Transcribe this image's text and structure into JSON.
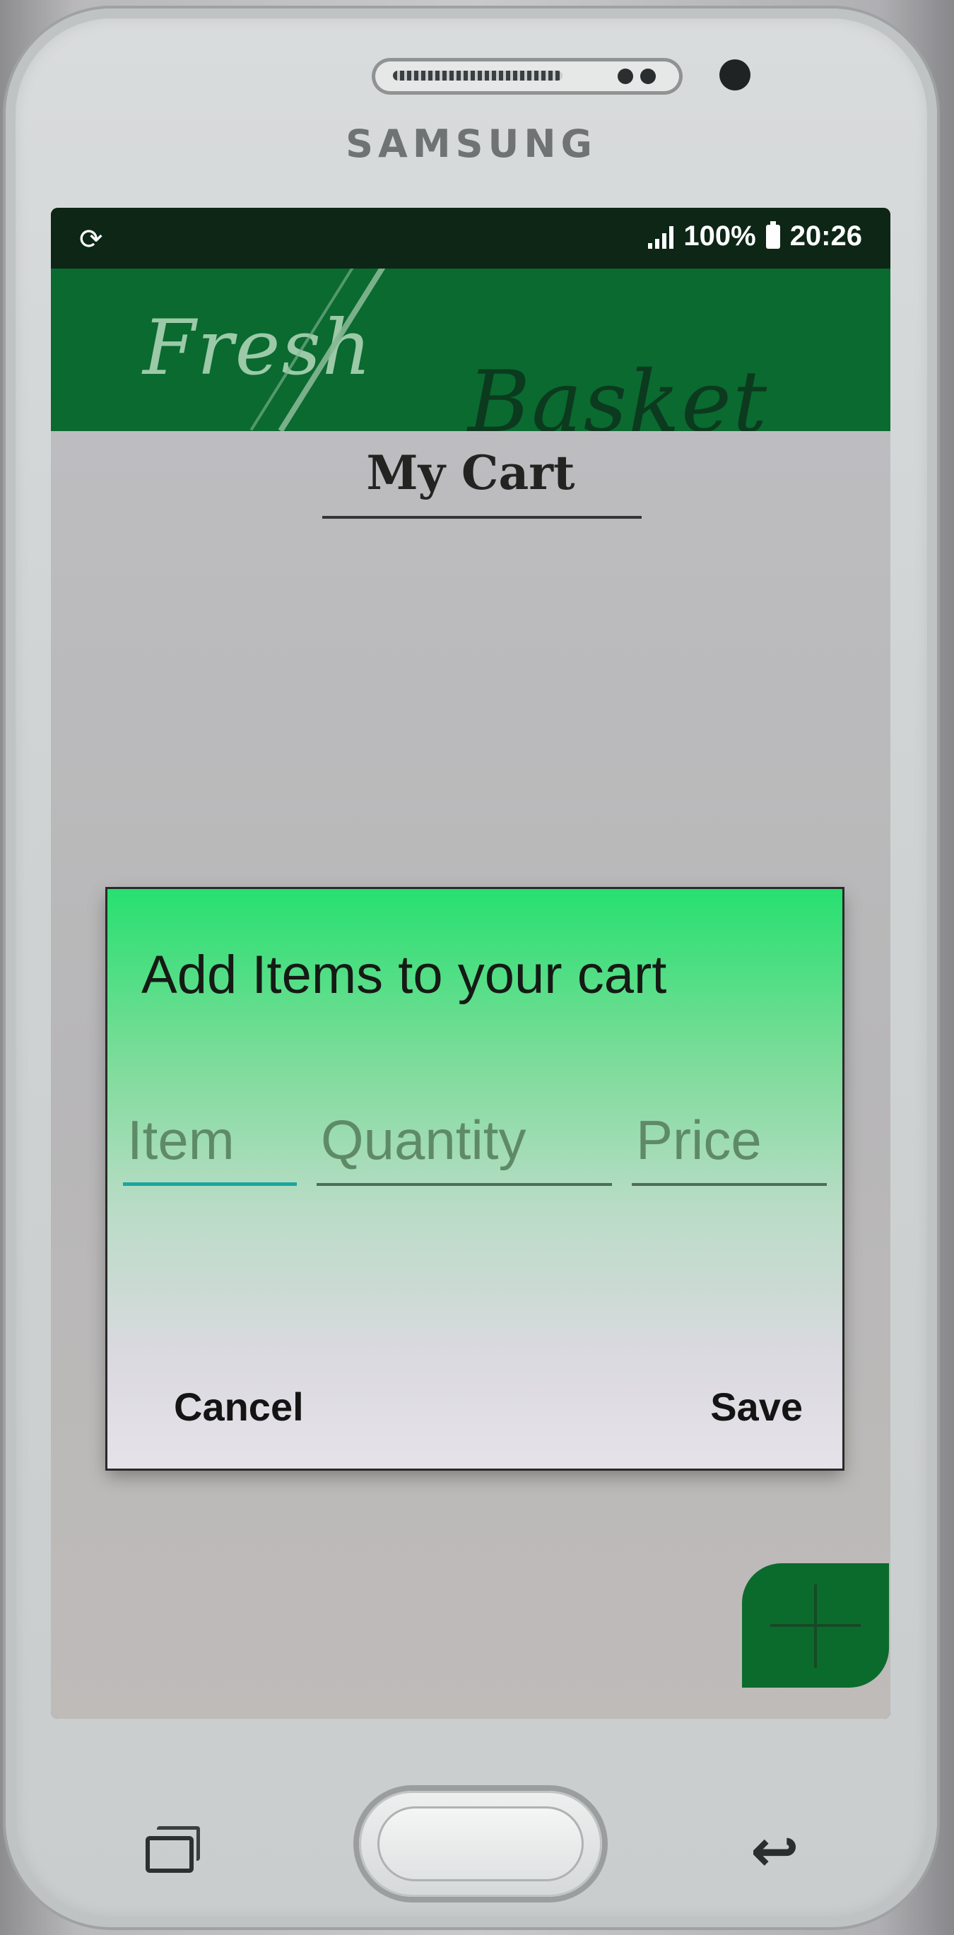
{
  "device": {
    "brand": "SAMSUNG"
  },
  "status_bar": {
    "sync_icon": "sync-icon",
    "signal_icon": "signal-bars-icon",
    "battery_percent": "100%",
    "battery_icon": "battery-icon",
    "time": "20:26"
  },
  "app_header": {
    "logo_word_1": "Fresh",
    "logo_word_2": "Basket",
    "background_color": "#0a6a30"
  },
  "page": {
    "title": "My Cart"
  },
  "dialog": {
    "title": "Add Items to your cart",
    "fields": {
      "item_placeholder": "Item",
      "quantity_placeholder": "Quantity",
      "price_placeholder": "Price"
    },
    "cancel_label": "Cancel",
    "save_label": "Save"
  },
  "fab": {
    "icon": "plus-icon",
    "color": "#0b6b2d"
  },
  "nav": {
    "recent_icon": "recent-apps-icon",
    "home_icon": "home-button",
    "back_icon": "back-icon"
  }
}
